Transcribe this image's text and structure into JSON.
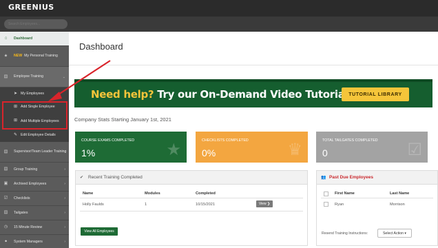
{
  "app": {
    "logo": "GREENIUS"
  },
  "search": {
    "placeholder": "Search Employees..."
  },
  "sidebar": {
    "items": [
      {
        "label": "Dashboard",
        "icon": "home-icon"
      },
      {
        "badge": "NEW",
        "label": "My Personal Training",
        "icon": "star-icon"
      },
      {
        "label": "Employee Training",
        "icon": "document-icon"
      },
      {
        "label": "My Employees",
        "icon": "paper-plane-icon"
      },
      {
        "label": "Add Single Employee",
        "icon": "plus-square-icon"
      },
      {
        "label": "Add Multiple Employees",
        "icon": "plus-square-icon"
      },
      {
        "label": "Edit Employee Details",
        "icon": "pencil-icon"
      },
      {
        "label": "Supervisor/Team Leader Training",
        "icon": "document-icon"
      },
      {
        "label": "Group Training",
        "icon": "document-icon"
      },
      {
        "label": "Archived Employees",
        "icon": "archive-icon"
      },
      {
        "label": "Checklists",
        "icon": "checklist-icon"
      },
      {
        "label": "Tailgates",
        "icon": "document-icon"
      },
      {
        "label": "15 Minute Review",
        "icon": "clock-icon"
      },
      {
        "label": "System Managers",
        "icon": "user-icon"
      }
    ]
  },
  "main": {
    "title": "Dashboard",
    "promo": {
      "text_white": "Need help?",
      "text_rest": "Try our On-Demand Video Tutorials",
      "button": "TUTORIAL LIBRARY"
    },
    "stats_label": "Company Stats Starting January 1st, 2021",
    "cards": [
      {
        "label": "COURSE EXAMS COMPLETED",
        "value": "1%",
        "color": "#1e6b35"
      },
      {
        "label": "CHECKLISTS COMPLETED",
        "value": "0%",
        "color": "#f3a640"
      },
      {
        "label": "TOTAL TAILGATES COMPLETED",
        "value": "0",
        "color": "#a3a3a3"
      }
    ],
    "recent_training": {
      "title": "Recent Training Completed",
      "columns": [
        "Name",
        "Modules",
        "Completed"
      ],
      "rows": [
        {
          "name": "Holly Faulds",
          "modules": "1",
          "completed": "10/15/2021",
          "action": "View"
        }
      ],
      "button": "View All Employees"
    },
    "past_due": {
      "title": "Past Due Employees",
      "columns": [
        "First Name",
        "Last Name"
      ],
      "rows": [
        {
          "first": "Ryan",
          "last": "Morrison"
        }
      ],
      "resend_label": "Resend Training Instructions:",
      "select_label": "Select Action"
    }
  },
  "colors": {
    "brand_green": "#1e6b35",
    "accent_yellow": "#f5c53a",
    "alert_red": "#c9282d"
  }
}
